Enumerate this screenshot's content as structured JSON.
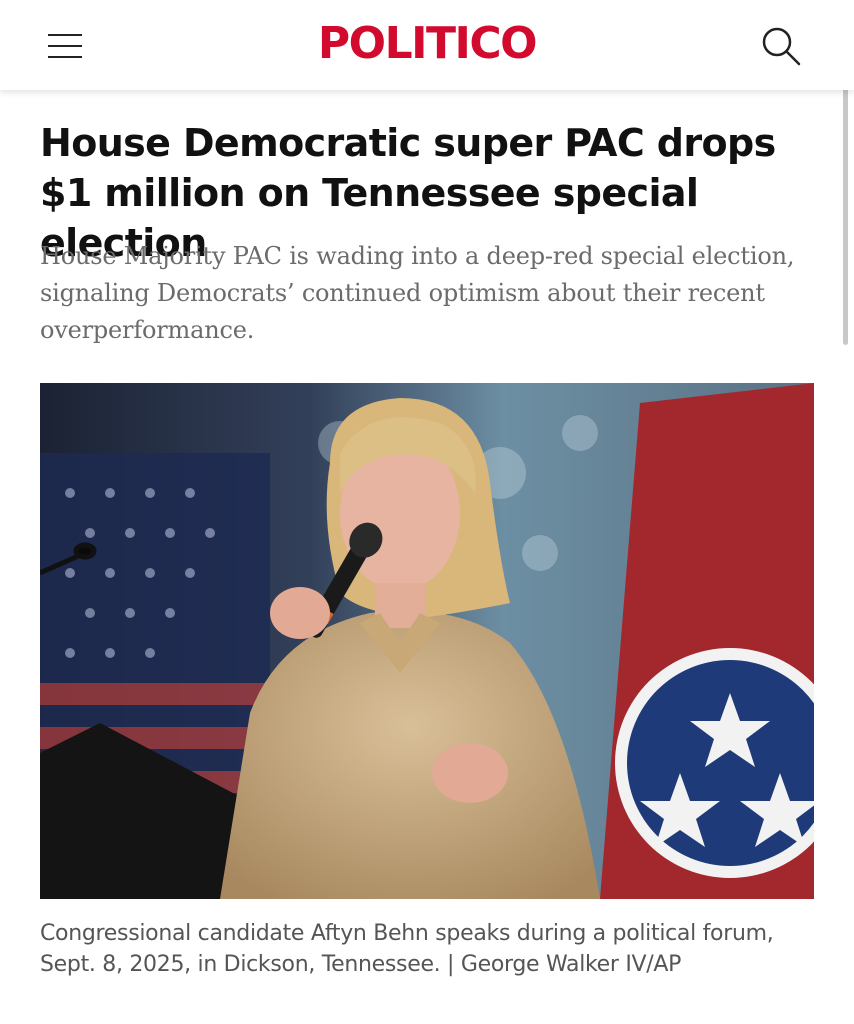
{
  "header": {
    "logo": "POLITICO",
    "menu_icon": "hamburger-menu-icon",
    "search_icon": "search-icon",
    "brand_color": "#d20a2e"
  },
  "article": {
    "headline": "House Democratic super PAC drops $1 million on Tennessee special election",
    "dek": "House Majority PAC is wading into a deep-red special election, signaling Democrats’ continued optimism about their recent overperformance.",
    "caption": "Congressional candidate Aftyn Behn speaks during a political forum, Sept. 8, 2025, in Dickson, Tennessee. | George Walker IV/AP"
  }
}
